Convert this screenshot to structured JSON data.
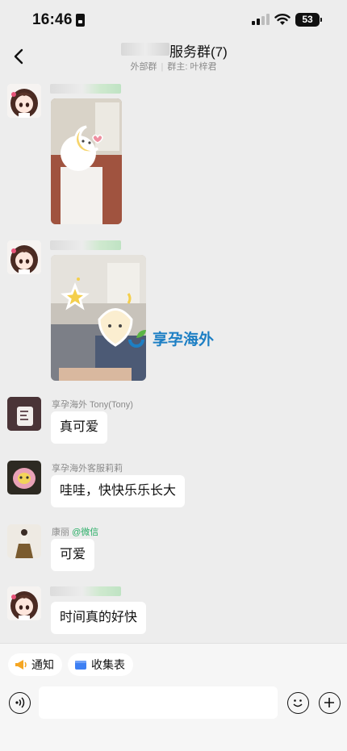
{
  "status_bar": {
    "time": "16:46",
    "battery": "53"
  },
  "header": {
    "title": "服务群(7)",
    "subtitle_left": "外部群",
    "subtitle_sep": "|",
    "subtitle_right": "群主: 叶梓君"
  },
  "messages": [
    {
      "sender": "",
      "kind": "image"
    },
    {
      "sender": "",
      "kind": "image",
      "watermark": "享孕海外"
    },
    {
      "sender": "享孕海外 Tony(Tony)",
      "kind": "text",
      "text": "真可爱"
    },
    {
      "sender": "享孕海外客服莉莉",
      "kind": "text",
      "text": "哇哇，快快乐乐长大"
    },
    {
      "sender": "康丽",
      "sender_tag": "@微信",
      "kind": "text",
      "text": "可爱"
    },
    {
      "sender": "",
      "kind": "text",
      "text": "时间真的好快"
    }
  ],
  "toolbar": {
    "notice_label": "通知",
    "form_label": "收集表"
  },
  "input": {
    "placeholder": ""
  },
  "colors": {
    "background": "#ededed",
    "bubble": "#ffffff",
    "accent_green": "#2aae67",
    "notice_orange": "#f5a623",
    "form_blue": "#3d7ff3"
  }
}
